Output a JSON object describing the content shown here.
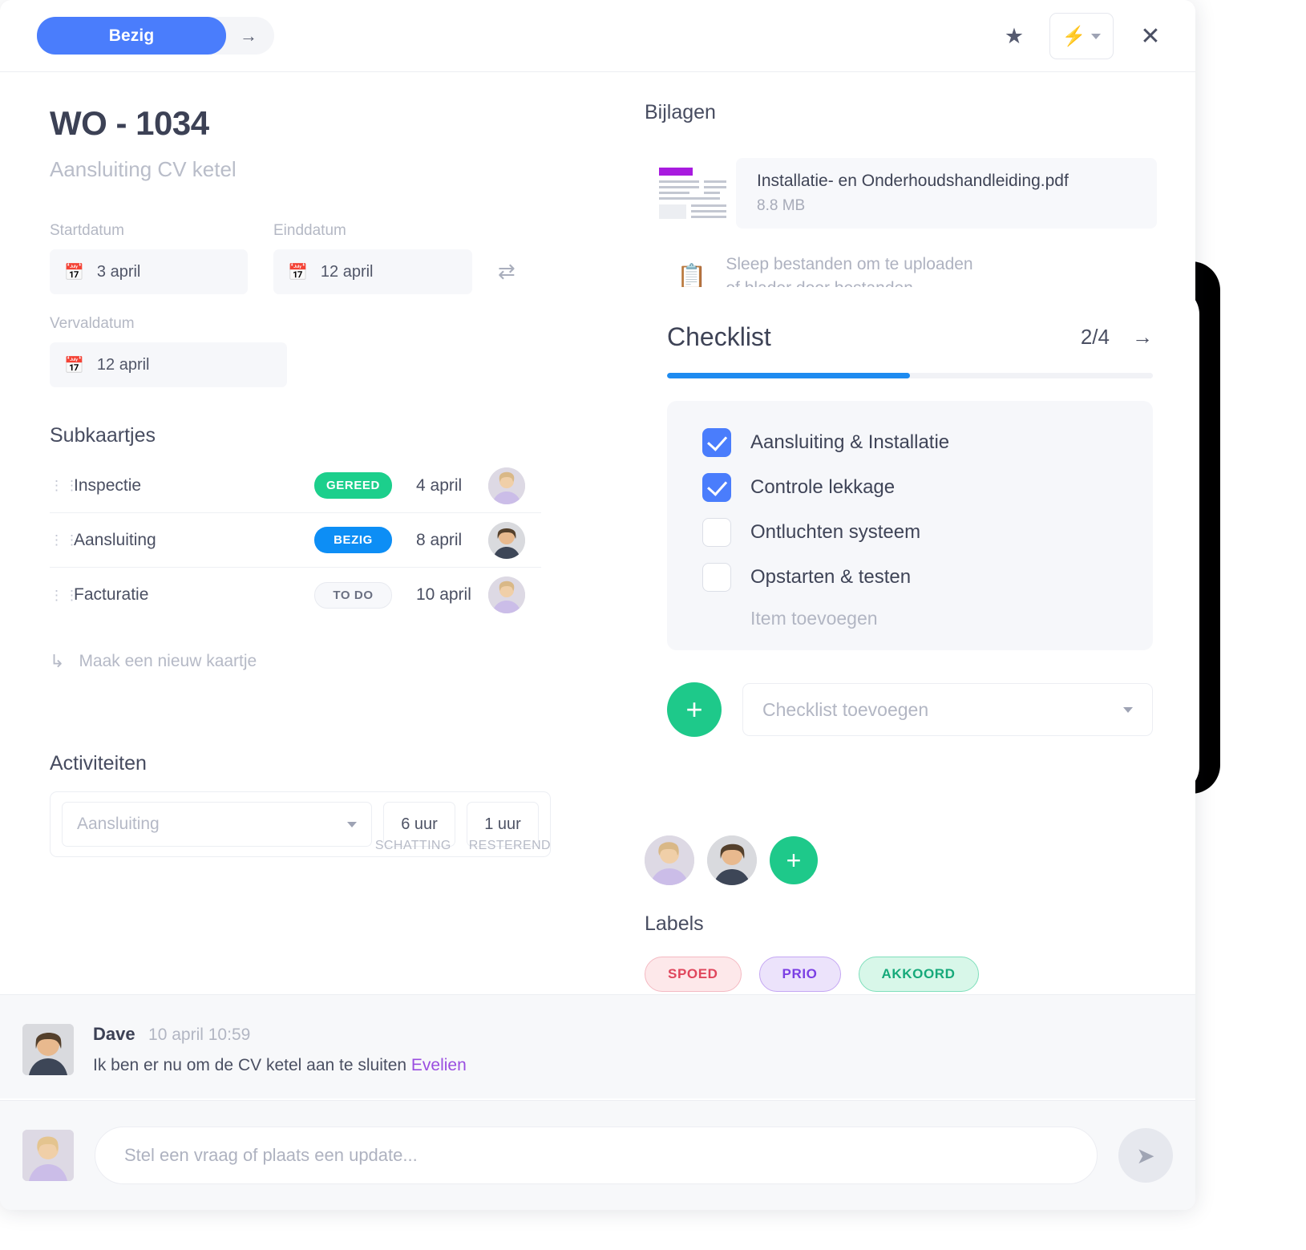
{
  "topbar": {
    "status_label": "Bezig",
    "next_icon": "arrow-right-icon",
    "star_icon": "star-icon",
    "bolt_icon": "lightning-bolt-icon",
    "close_icon": "close-icon"
  },
  "header": {
    "title": "WO - 1034",
    "subtitle": "Aansluiting CV ketel"
  },
  "dates": {
    "start_label": "Startdatum",
    "start_value": "3 april",
    "end_label": "Einddatum",
    "end_value": "12 april",
    "due_label": "Vervaldatum",
    "due_value": "12 april",
    "swap_icon": "swap-icon",
    "calendar_icon": "calendar-icon"
  },
  "subcards": {
    "title": "Subkaartjes",
    "rows": [
      {
        "name": "Inspectie",
        "status": "GEREED",
        "status_color": "#1ccf8c",
        "date": "4 april"
      },
      {
        "name": "Aansluiting",
        "status": "BEZIG",
        "status_color": "#0d8ef5",
        "date": "8 april"
      },
      {
        "name": "Facturatie",
        "status": "TO DO",
        "status_color": "#6b7082",
        "date": "10 april"
      }
    ],
    "new_card_label": "Maak een nieuw kaartje"
  },
  "activities": {
    "title": "Activiteiten",
    "col_estimate": "SCHATTING",
    "col_remaining": "RESTEREND",
    "select_value": "Aansluiting",
    "estimate": "6 uur",
    "remaining": "1 uur"
  },
  "attachments": {
    "title": "Bijlagen",
    "file_name": "Installatie- en Onderhoudshandleiding.pdf",
    "file_size": "8.8 MB",
    "drop_line1": "Sleep bestanden om te uploaden",
    "drop_line2": "of blader door bestanden"
  },
  "members": {
    "add_label": "+"
  },
  "labels": {
    "title": "Labels",
    "pills": [
      {
        "text": "SPOED",
        "color": "#e0465c"
      },
      {
        "text": "PRIO",
        "color": "#7b3fe4"
      },
      {
        "text": "AKKOORD",
        "color": "#16a97a"
      }
    ]
  },
  "checklist": {
    "title": "Checklist",
    "count": "2/4",
    "arrow_icon": "arrow-right-icon",
    "progress_percent": 50,
    "items": [
      {
        "label": "Aansluiting & Installatie",
        "checked": true
      },
      {
        "label": "Controle lekkage",
        "checked": true
      },
      {
        "label": "Ontluchten systeem",
        "checked": false
      },
      {
        "label": "Opstarten & testen",
        "checked": false
      }
    ],
    "add_item_label": "Item toevoegen",
    "add_button": "+",
    "add_select_placeholder": "Checklist toevoegen"
  },
  "comment": {
    "author": "Dave",
    "time": "10 april 10:59",
    "text_before": "Ik ben er nu om de CV ketel aan te sluiten ",
    "mention": "Evelien"
  },
  "composer": {
    "placeholder": "Stel een vraag of plaats een update...",
    "send_icon": "send-icon"
  }
}
